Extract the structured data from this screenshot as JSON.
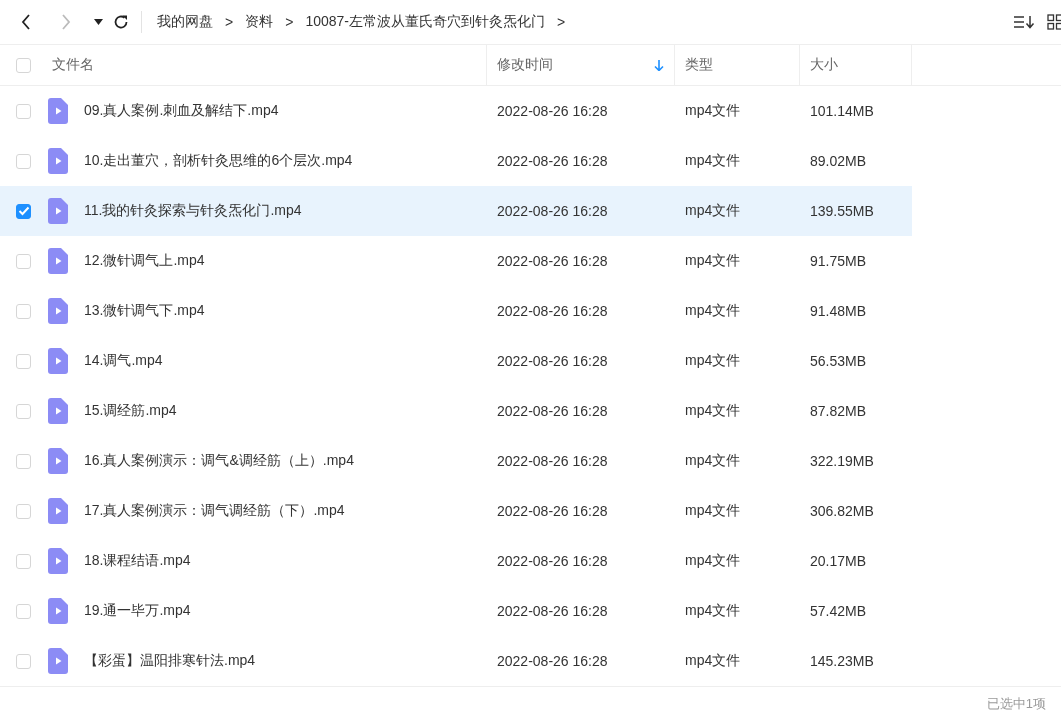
{
  "toolbar": {
    "back": {
      "disabled": false
    },
    "forward": {
      "disabled": true
    },
    "breadcrumb": [
      {
        "label": "我的网盘",
        "separator": ">"
      },
      {
        "label": "资料",
        "separator": ">"
      },
      {
        "label": "10087-左常波从董氏奇穴到针灸炁化门",
        "separator": ">"
      }
    ]
  },
  "table": {
    "select_all": {
      "checked": false
    },
    "columns": [
      {
        "label": "文件名",
        "sorted": false
      },
      {
        "label": "修改时间",
        "sorted": true
      },
      {
        "label": "类型",
        "sorted": false
      },
      {
        "label": "大小",
        "sorted": false
      }
    ],
    "rows": [
      {
        "name": "09.真人案例.刺血及解结下.mp4",
        "modified": "2022-08-26 16:28",
        "type": "mp4文件",
        "size": "101.14MB",
        "selected": false
      },
      {
        "name": "10.走出董穴，剖析针灸思维的6个层次.mp4",
        "modified": "2022-08-26 16:28",
        "type": "mp4文件",
        "size": "89.02MB",
        "selected": false
      },
      {
        "name": "11.我的针灸探索与针灸炁化门.mp4",
        "modified": "2022-08-26 16:28",
        "type": "mp4文件",
        "size": "139.55MB",
        "selected": true
      },
      {
        "name": "12.微针调气上.mp4",
        "modified": "2022-08-26 16:28",
        "type": "mp4文件",
        "size": "91.75MB",
        "selected": false
      },
      {
        "name": "13.微针调气下.mp4",
        "modified": "2022-08-26 16:28",
        "type": "mp4文件",
        "size": "91.48MB",
        "selected": false
      },
      {
        "name": "14.调气.mp4",
        "modified": "2022-08-26 16:28",
        "type": "mp4文件",
        "size": "56.53MB",
        "selected": false
      },
      {
        "name": "15.调经筋.mp4",
        "modified": "2022-08-26 16:28",
        "type": "mp4文件",
        "size": "87.82MB",
        "selected": false
      },
      {
        "name": "16.真人案例演示：调气&调经筋（上）.mp4",
        "modified": "2022-08-26 16:28",
        "type": "mp4文件",
        "size": "322.19MB",
        "selected": false
      },
      {
        "name": "17.真人案例演示：调气调经筋（下）.mp4",
        "modified": "2022-08-26 16:28",
        "type": "mp4文件",
        "size": "306.82MB",
        "selected": false
      },
      {
        "name": "18.课程结语.mp4",
        "modified": "2022-08-26 16:28",
        "type": "mp4文件",
        "size": "20.17MB",
        "selected": false
      },
      {
        "name": "19.通一毕万.mp4",
        "modified": "2022-08-26 16:28",
        "type": "mp4文件",
        "size": "57.42MB",
        "selected": false
      },
      {
        "name": "【彩蛋】温阳排寒针法.mp4",
        "modified": "2022-08-26 16:28",
        "type": "mp4文件",
        "size": "145.23MB",
        "selected": false
      }
    ]
  },
  "status_bar": {
    "selection": "已选中1项"
  }
}
